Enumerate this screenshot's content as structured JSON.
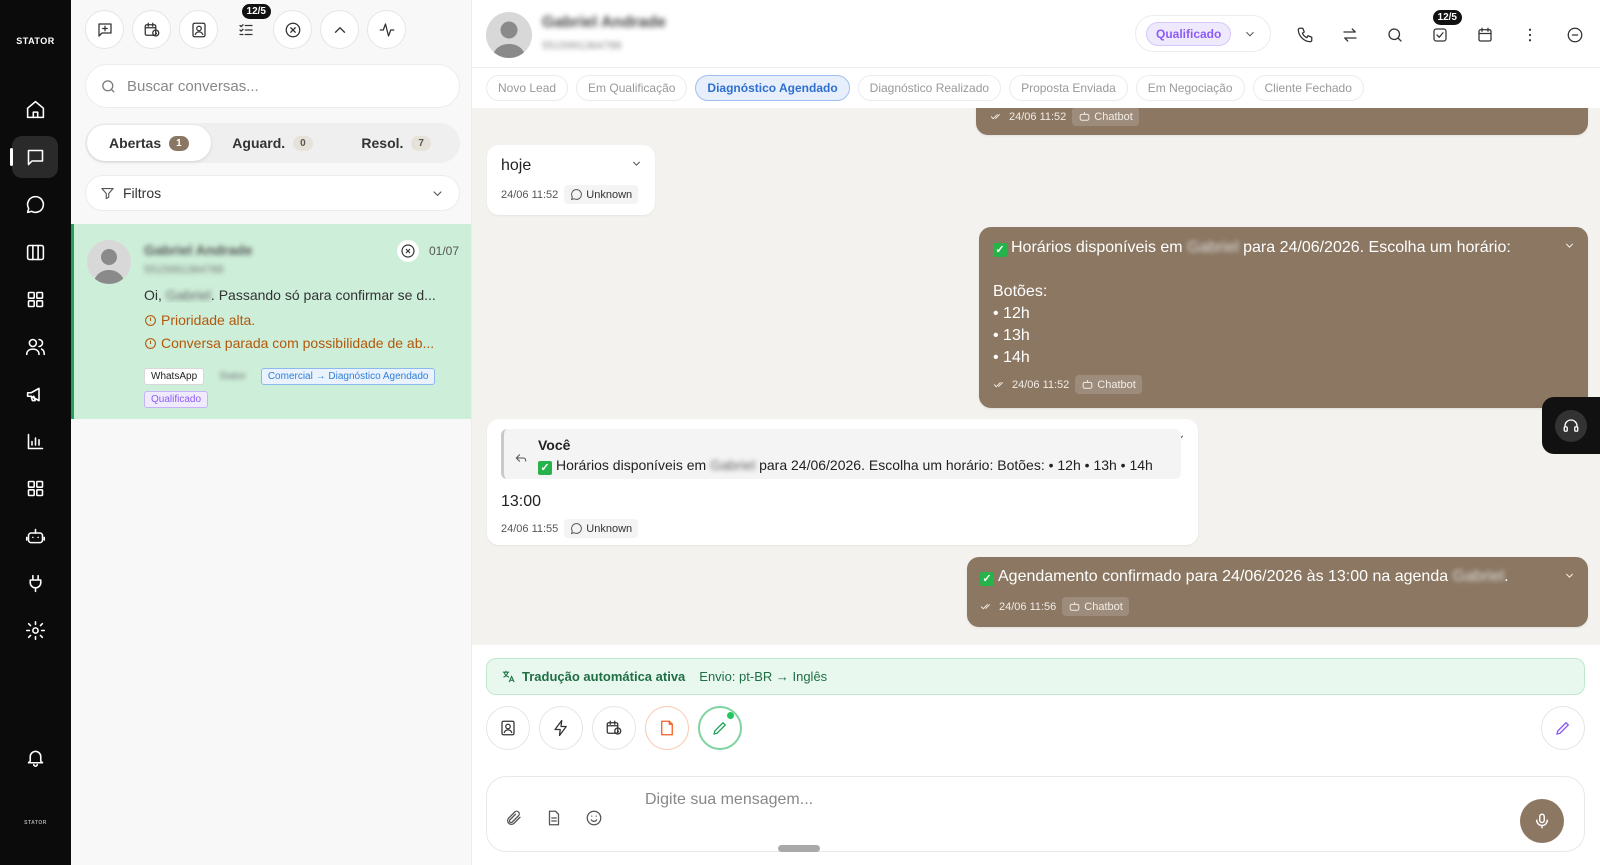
{
  "app": {
    "brand": "STATOR"
  },
  "rail": {
    "items": [
      "home-icon",
      "chat-icon",
      "message-circle-icon",
      "kanban-icon",
      "grid-icon",
      "users-icon",
      "megaphone-icon",
      "bar-chart-icon",
      "apps-icon",
      "bot-icon",
      "plug-icon",
      "settings-icon",
      "bell-icon"
    ],
    "active": "chat-icon"
  },
  "toolbar": {
    "badge": "12/5"
  },
  "search": {
    "placeholder": "Buscar conversas...",
    "value": ""
  },
  "tabs": [
    {
      "label": "Abertas",
      "count": "1",
      "active": true
    },
    {
      "label": "Aguard.",
      "count": "0",
      "active": false
    },
    {
      "label": "Resol.",
      "count": "7",
      "active": false
    }
  ],
  "filters": {
    "label": "Filtros"
  },
  "conversation": {
    "name": "Gabriel Andrade",
    "phone": "5515991364788",
    "date": "01/07",
    "preview_start": "Oi, ",
    "preview_redacted": "Gabriel",
    "preview_end": ". Passando só para confirmar se d...",
    "alert_priority": "Prioridade alta.",
    "alert_stalled": "Conversa parada com possibilidade de ab...",
    "tag_channel": "WhatsApp",
    "tag_redacted": "Stator",
    "tag_pipeline": "Comercial → Diagnóstico Agendado",
    "tag_status": "Qualificado"
  },
  "header": {
    "contact_name": "Gabriel Andrade",
    "contact_phone": "5515991364788",
    "status": "Qualificado",
    "tasks_badge": "12/5"
  },
  "stages": [
    {
      "label": "Novo Lead",
      "active": false
    },
    {
      "label": "Em Qualificação",
      "active": false
    },
    {
      "label": "Diagnóstico Agendado",
      "active": true
    },
    {
      "label": "Diagnóstico Realizado",
      "active": false
    },
    {
      "label": "Proposta Enviada",
      "active": false
    },
    {
      "label": "Em Negociação",
      "active": false
    },
    {
      "label": "Cliente Fechado",
      "active": false
    }
  ],
  "messages": {
    "partial": {
      "time": "24/06 11:52",
      "sender": "Chatbot"
    },
    "incoming_1": {
      "text": "hoje",
      "time": "24/06 11:52",
      "sender": "Unknown"
    },
    "outgoing_1": {
      "line_start": "Horários disponíveis em ",
      "redacted": "Gabriel",
      "line_end": " para 24/06/2026. Escolha um horário:",
      "buttons_label": "Botões:",
      "options": [
        "• 12h",
        "• 13h",
        "• 14h"
      ],
      "time": "24/06 11:52",
      "sender": "Chatbot"
    },
    "incoming_2": {
      "quote_author": "Você",
      "quote_start": "Horários disponíveis em ",
      "quote_redacted": "Gabriel",
      "quote_end": " para 24/06/2026. Escolha um horário: Botões: • 12h • 13h • 14h",
      "text": "13:00",
      "time": "24/06 11:55",
      "sender": "Unknown"
    },
    "outgoing_2": {
      "text_start": "Agendamento confirmado para 24/06/2026 às 13:00 na agenda ",
      "redacted": "Gabriel",
      "text_end": ".",
      "time": "24/06 11:56",
      "sender": "Chatbot"
    }
  },
  "translation": {
    "title": "Tradução automática ativa",
    "detail": "Envio: pt-BR → Inglês"
  },
  "composer": {
    "placeholder": "Digite sua mensagem...",
    "value": ""
  },
  "colors": {
    "outgoing_bubble": "#8b7762",
    "accent_green": "#21a35a",
    "status_purple": "#8b5cf6",
    "stage_blue": "#2f6fd0"
  }
}
